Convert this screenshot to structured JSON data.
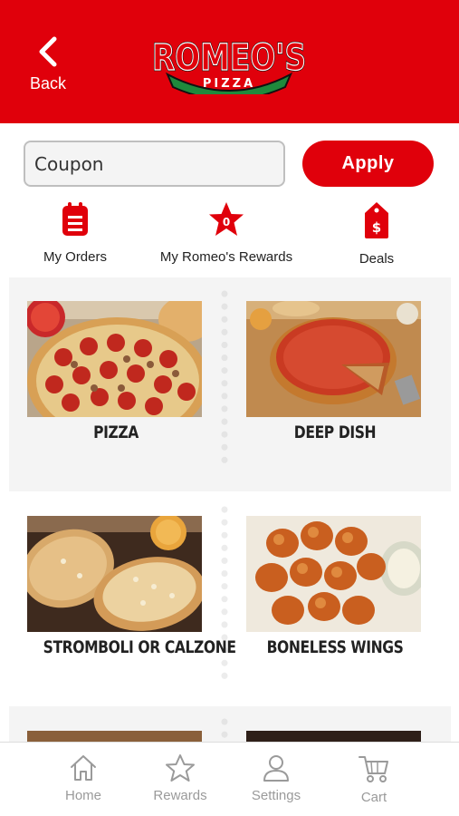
{
  "header": {
    "back_label": "Back",
    "logo_text": "ROMEO'S",
    "logo_subtext": "PIZZA"
  },
  "coupon": {
    "placeholder": "Coupon",
    "apply_label": "Apply"
  },
  "quick_actions": [
    {
      "label": "My Orders",
      "icon": "clipboard-icon"
    },
    {
      "label": "My Romeo's Rewards",
      "icon": "star-badge-icon",
      "badge": "0"
    },
    {
      "label": "Deals",
      "icon": "price-tag-icon"
    }
  ],
  "menu": {
    "categories": [
      {
        "label": "PIZZA",
        "image": "pepperoni-pizza-photo"
      },
      {
        "label": "DEEP DISH",
        "image": "deep-dish-pizza-photo"
      },
      {
        "label": "STROMBOLI OR CALZONE",
        "image": "stromboli-calzone-photo"
      },
      {
        "label": "BONELESS WINGS",
        "image": "boneless-wings-photo"
      }
    ]
  },
  "tabbar": {
    "tabs": [
      {
        "label": "Home",
        "icon": "home-icon"
      },
      {
        "label": "Rewards",
        "icon": "star-icon"
      },
      {
        "label": "Settings",
        "icon": "person-icon"
      },
      {
        "label": "Cart",
        "icon": "cart-icon"
      }
    ]
  },
  "colors": {
    "brand_red": "#e0000b",
    "logo_green": "#1f8a3c",
    "tab_gray": "#9a9a9a"
  }
}
